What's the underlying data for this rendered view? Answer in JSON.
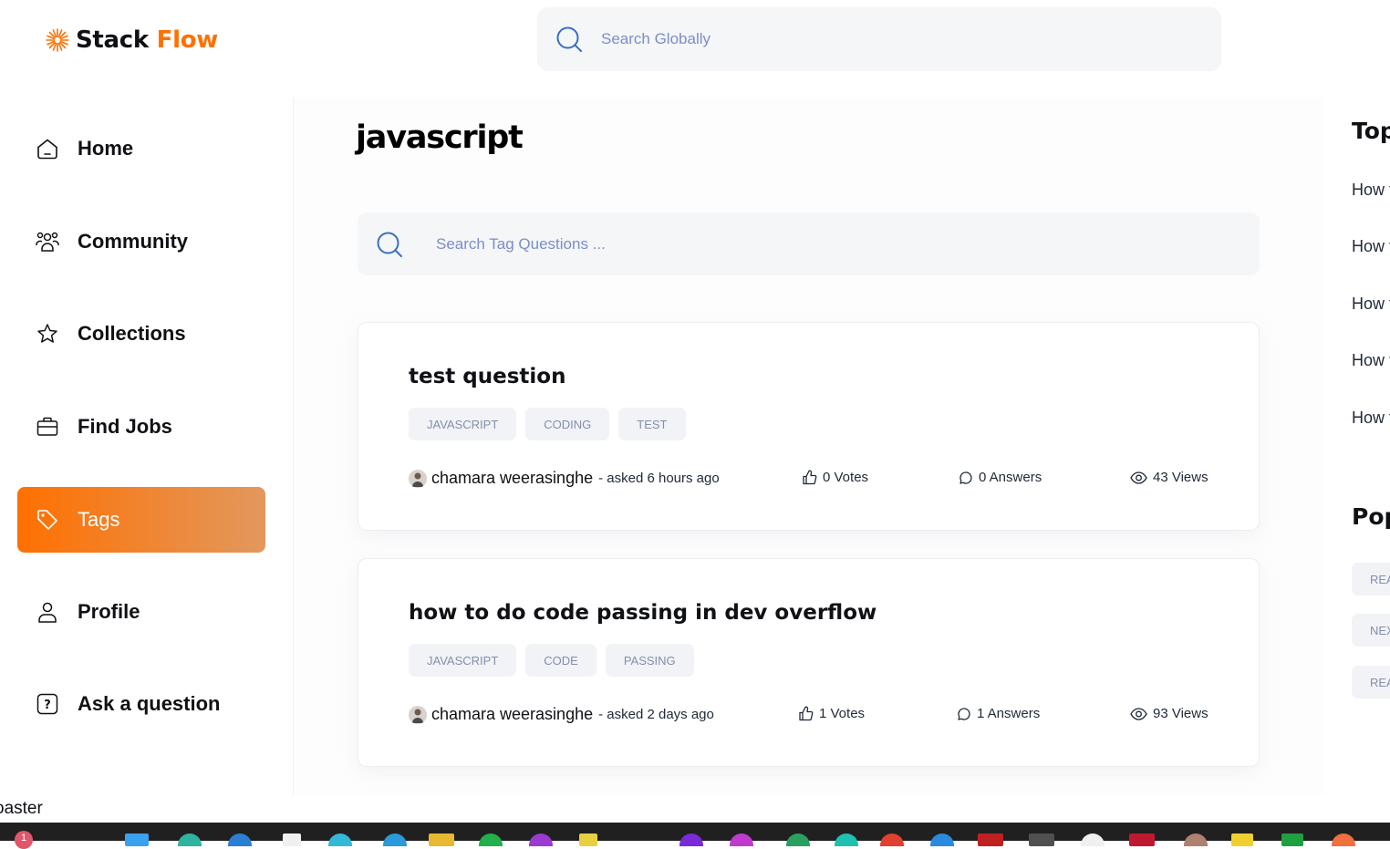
{
  "header": {
    "brand_part1": "Stack",
    "brand_part2": "Flow",
    "global_search_placeholder": "Search Globally",
    "accent_color": "#ff7000"
  },
  "sidebar": {
    "items": [
      {
        "label": "Home",
        "icon": "home-icon",
        "active": false
      },
      {
        "label": "Community",
        "icon": "users-icon",
        "active": false
      },
      {
        "label": "Collections",
        "icon": "star-icon",
        "active": false
      },
      {
        "label": "Find Jobs",
        "icon": "suitcase-icon",
        "active": false
      },
      {
        "label": "Tags",
        "icon": "tag-icon",
        "active": true
      },
      {
        "label": "Profile",
        "icon": "user-icon",
        "active": false
      },
      {
        "label": "Ask a question",
        "icon": "question-icon",
        "active": false
      }
    ]
  },
  "main": {
    "page_title": "javascript",
    "tag_search_placeholder": "Search Tag Questions ...",
    "questions": [
      {
        "title": "test question",
        "tags": [
          "JAVASCRIPT",
          "CODING",
          "TEST"
        ],
        "author": "chamara weerasinghe",
        "asked": "- asked 6 hours ago",
        "votes": "0 Votes",
        "answers": "0 Answers",
        "views": "43 Views"
      },
      {
        "title": "how to do code passing in dev overflow",
        "tags": [
          "JAVASCRIPT",
          "CODE",
          "PASSING"
        ],
        "author": "chamara weerasinghe",
        "asked": "- asked 2 days ago",
        "votes": "1 Votes",
        "answers": "1 Answers",
        "views": "93 Views"
      }
    ]
  },
  "rightbar": {
    "top_heading": "Top",
    "top_links": [
      "How t",
      "How t",
      "How t",
      "How t",
      "How t"
    ],
    "popular_heading": "Pop",
    "popular_tags": [
      "REA",
      "NEX",
      "REA"
    ]
  },
  "footer": {
    "toaster_text": "oaster",
    "taskbar_badge": "1"
  }
}
